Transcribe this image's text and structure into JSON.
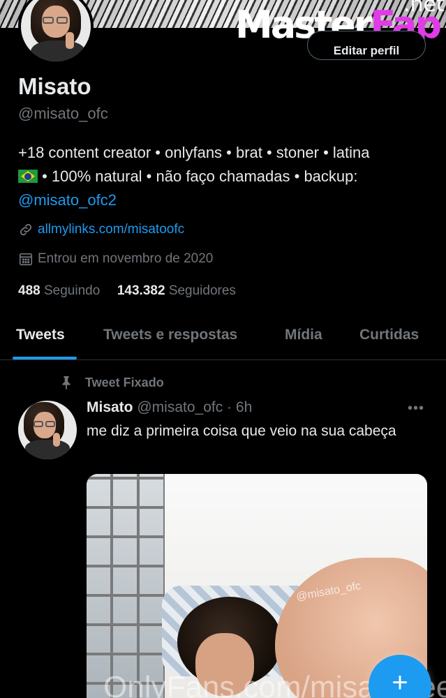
{
  "watermark": {
    "part1": "Master",
    "part2": "Fap",
    "suffix": ".net"
  },
  "profile": {
    "name": "Misato",
    "handle": "@misato_ofc",
    "edit_button": "Editar perfil",
    "bio": {
      "line1": "+18 content creator • onlyfans • brat • stoner • latina",
      "line2": " • 100% natural • não faço chamadas • backup:",
      "mention": "@misato_ofc2",
      "flag_icon": "brazil-flag"
    },
    "website": "allmylinks.com/misatoofc",
    "joined": "Entrou em novembro de 2020",
    "following_count": "488",
    "following_label": "Seguindo",
    "followers_count": "143.382",
    "followers_label": "Seguidores"
  },
  "tabs": [
    {
      "label": "Tweets",
      "active": true
    },
    {
      "label": "Tweets e respostas",
      "active": false
    },
    {
      "label": "Mídia",
      "active": false
    },
    {
      "label": "Curtidas",
      "active": false
    }
  ],
  "tweet": {
    "pinned_label": "Tweet Fixado",
    "author_name": "Misato",
    "author_handle_time": "@misato_ofc · 6h",
    "more_label": "•••",
    "text": "me diz a primeira coisa que veio na sua cabeça",
    "media_watermark": "@misato_ofc",
    "media_overlay_text": "OnlyFans.com/misatofree"
  },
  "fab": {
    "label": "+"
  },
  "colors": {
    "accent": "#1d9bf0",
    "muted": "#71767b",
    "text": "#e7e9ea",
    "background": "#000000"
  }
}
